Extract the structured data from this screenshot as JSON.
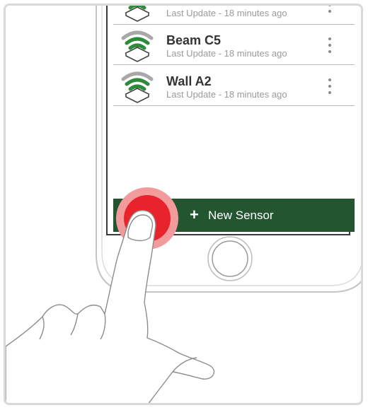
{
  "sensors": [
    {
      "name": "",
      "update": "Last Update - 18 minutes ago",
      "icon": "wifi-sensor-icon"
    },
    {
      "name": "Beam C5",
      "update": "Last Update - 18 minutes ago",
      "icon": "wifi-sensor-icon"
    },
    {
      "name": "Wall A2",
      "update": "Last Update - 18 minutes ago",
      "icon": "wifi-sensor-icon"
    }
  ],
  "action_bar": {
    "plus": "+",
    "label": "New Sensor"
  },
  "colors": {
    "action_bar": "#225530",
    "signal_green": "#2e8b3d",
    "signal_gray": "#a8a8a8",
    "touch_red": "#e8232b",
    "touch_halo": "#f39a9d"
  },
  "icons": [
    "wifi-sensor-icon",
    "overflow-menu-icon",
    "plus-icon",
    "home-button",
    "finger-pointer"
  ]
}
